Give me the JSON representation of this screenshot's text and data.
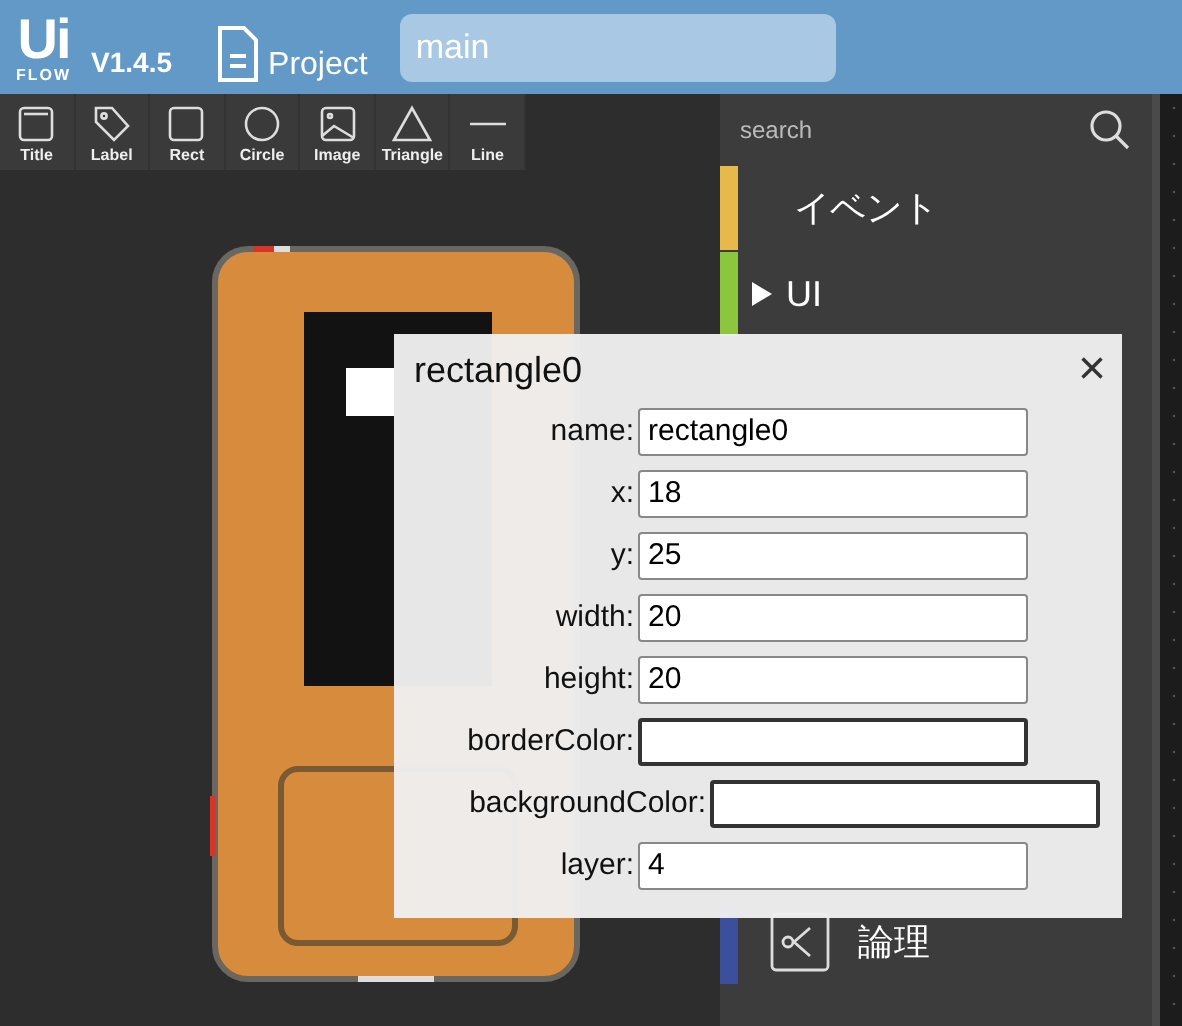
{
  "header": {
    "logo": "Ui",
    "logo_sub": "FLOW",
    "version": "V1.4.5",
    "project_label": "Project",
    "file_name": "main"
  },
  "tools": [
    {
      "label": "Title",
      "kind": "title"
    },
    {
      "label": "Label",
      "kind": "label"
    },
    {
      "label": "Rect",
      "kind": "rect"
    },
    {
      "label": "Circle",
      "kind": "circle"
    },
    {
      "label": "Image",
      "kind": "image"
    },
    {
      "label": "Triangle",
      "kind": "triangle"
    },
    {
      "label": "Line",
      "kind": "line"
    }
  ],
  "sidebar": {
    "search_placeholder": "search",
    "items": [
      {
        "label": "イベント",
        "color": "#e6b94a",
        "kind": "plain"
      },
      {
        "label": "UI",
        "color": "#8cc63f",
        "kind": "arrow"
      },
      {
        "label": "論理",
        "color": "#3c4f9c",
        "kind": "logic"
      }
    ]
  },
  "dialog": {
    "title": "rectangle0",
    "close": "×",
    "fields": [
      {
        "label": "name:",
        "value": "rectangle0",
        "kind": "text"
      },
      {
        "label": "x:",
        "value": "18",
        "kind": "text"
      },
      {
        "label": "y:",
        "value": "25",
        "kind": "text"
      },
      {
        "label": "width:",
        "value": "20",
        "kind": "text"
      },
      {
        "label": "height:",
        "value": "20",
        "kind": "text"
      },
      {
        "label": "borderColor:",
        "kind": "color"
      },
      {
        "label": "backgroundColor:",
        "kind": "color"
      },
      {
        "label": "layer:",
        "value": "4",
        "kind": "text"
      }
    ]
  }
}
